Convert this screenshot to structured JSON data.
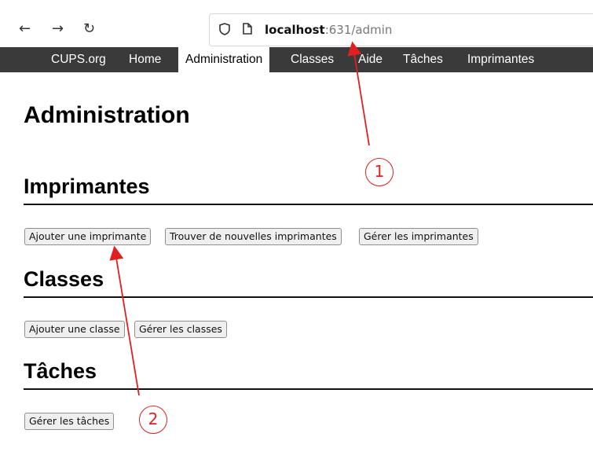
{
  "browser": {
    "back_icon": "arrow-left-icon",
    "forward_icon": "arrow-right-icon",
    "reload_icon": "reload-icon",
    "shield_icon": "shield-icon",
    "page_icon": "page-icon",
    "url_host": "localhost",
    "url_rest": ":631/admin"
  },
  "nav": {
    "items": [
      {
        "label": "CUPS.org"
      },
      {
        "label": "Home"
      },
      {
        "label": "Administration"
      },
      {
        "label": "Classes"
      },
      {
        "label": "Aide"
      },
      {
        "label": "Tâches"
      },
      {
        "label": "Imprimantes"
      }
    ],
    "active_index": 2
  },
  "page": {
    "title": "Administration",
    "sections": {
      "printers": {
        "heading": "Imprimantes",
        "buttons": [
          "Ajouter une imprimante",
          "Trouver de nouvelles imprimantes",
          "Gérer les imprimantes"
        ]
      },
      "classes": {
        "heading": "Classes",
        "buttons": [
          "Ajouter une classe",
          "Gérer les classes"
        ]
      },
      "jobs": {
        "heading": "Tâches",
        "buttons": [
          "Gérer les tâches"
        ]
      }
    }
  },
  "annotations": {
    "callouts": [
      "1",
      "2"
    ],
    "color": "#e02020"
  }
}
